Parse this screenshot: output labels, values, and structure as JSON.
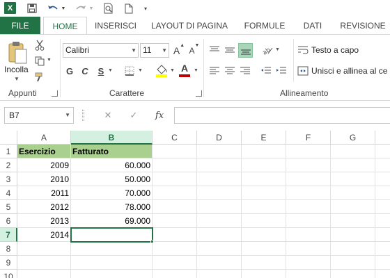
{
  "quick_access": {
    "app_icon": "X",
    "icons": [
      "excel-icon",
      "save-icon",
      "undo-icon",
      "redo-icon",
      "print-preview-icon",
      "new-document-icon",
      "customize-icon"
    ]
  },
  "tabs": {
    "file": "FILE",
    "home": "HOME",
    "insert": "INSERISCI",
    "layout": "LAYOUT DI PAGINA",
    "formulas": "FORMULE",
    "data": "DATI",
    "review": "REVISIONE"
  },
  "ribbon": {
    "clipboard": {
      "paste_label": "Incolla",
      "group_label": "Appunti"
    },
    "font": {
      "font_name": "Calibri",
      "font_size": "11",
      "grow": "A",
      "shrink": "A",
      "bold": "G",
      "italic": "C",
      "underline": "S",
      "font_color_letter": "A",
      "group_label": "Carattere"
    },
    "alignment": {
      "wrap_text": "Testo a capo",
      "merge_center": "Unisci e allinea al ce",
      "group_label": "Allineamento"
    }
  },
  "formula_bar": {
    "name_box": "B7",
    "cancel": "✕",
    "enter": "✓",
    "fx": "fx",
    "value": ""
  },
  "sheet": {
    "columns": [
      "A",
      "B",
      "C",
      "D",
      "E",
      "F",
      "G"
    ],
    "rows": [
      "1",
      "2",
      "3",
      "4",
      "5",
      "6",
      "7",
      "8",
      "9",
      "10"
    ],
    "selected_cell": "B7",
    "header": [
      "Esercizio",
      "Fatturato"
    ],
    "data": [
      [
        "2009",
        "60.000"
      ],
      [
        "2010",
        "50.000"
      ],
      [
        "2011",
        "70.000"
      ],
      [
        "2012",
        "78.000"
      ],
      [
        "2013",
        "69.000"
      ],
      [
        "2014",
        ""
      ]
    ]
  },
  "colors": {
    "accent": "#217346",
    "header_fill": "#a9d08e",
    "selected_header": "#d3f0e0"
  }
}
